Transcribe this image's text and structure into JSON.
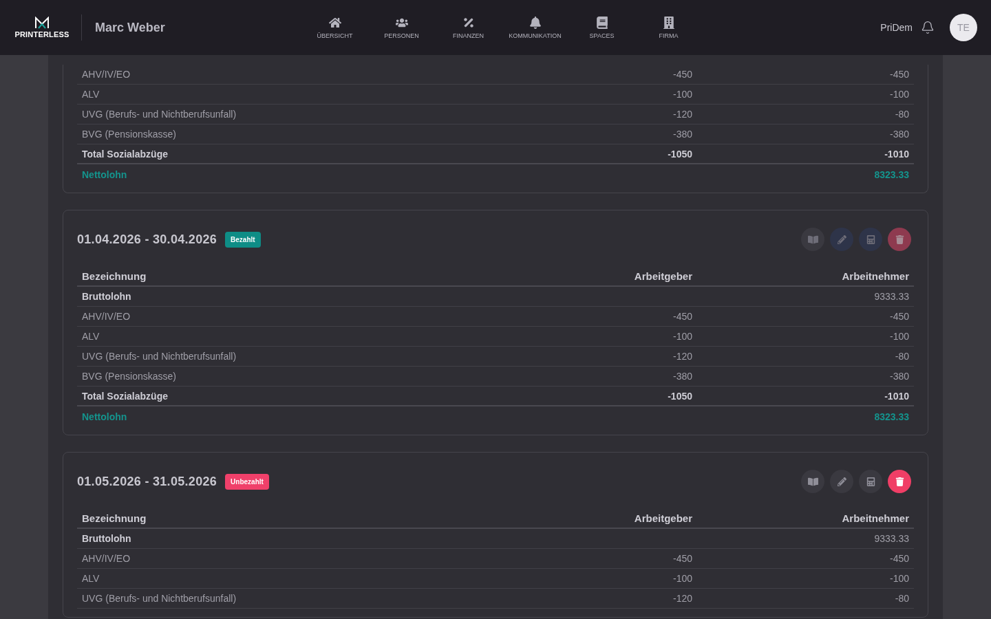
{
  "header": {
    "logo": "PRINTERLESS",
    "user_name": "Marc Weber",
    "nav": [
      {
        "label": "ÜBERSICHT",
        "kind": "home"
      },
      {
        "label": "PERSONEN",
        "kind": "people"
      },
      {
        "label": "FINANZEN",
        "kind": "finance"
      },
      {
        "label": "KOMMUNIKATION",
        "kind": "messages"
      },
      {
        "label": "SPACES",
        "kind": "spaces"
      },
      {
        "label": "FIRMA",
        "kind": "company"
      }
    ],
    "company": "PriDem",
    "avatar": "TE"
  },
  "cards": [
    {
      "partial": true,
      "rows": [
        {
          "kind": "item",
          "label": "AHV/IV/EO",
          "employer": "-450",
          "employee": "-450"
        },
        {
          "kind": "item",
          "label": "ALV",
          "employer": "-100",
          "employee": "-100"
        },
        {
          "kind": "item",
          "label": "UVG (Berufs- und Nichtberufsunfall)",
          "employer": "-120",
          "employee": "-80"
        },
        {
          "kind": "item",
          "label": "BVG (Pensionskasse)",
          "employer": "-380",
          "employee": "-380"
        },
        {
          "kind": "total",
          "label": "Total Sozialabzüge",
          "employer": "-1050",
          "employee": "-1010"
        },
        {
          "kind": "net",
          "label": "Nettolohn",
          "employee": "8323.33"
        }
      ]
    },
    {
      "partial": false,
      "period": "01.04.2026 - 30.04.2026",
      "status": {
        "label": "Bezahlt",
        "paid": true
      },
      "actions_disabled": true,
      "columns": [
        "Bezeichnung",
        "Arbeitgeber",
        "Arbeitnehmer"
      ],
      "rows": [
        {
          "kind": "gross",
          "label": "Bruttolohn",
          "employee": "9333.33"
        },
        {
          "kind": "item",
          "label": "AHV/IV/EO",
          "employer": "-450",
          "employee": "-450"
        },
        {
          "kind": "item",
          "label": "ALV",
          "employer": "-100",
          "employee": "-100"
        },
        {
          "kind": "item",
          "label": "UVG (Berufs- und Nichtberufsunfall)",
          "employer": "-120",
          "employee": "-80"
        },
        {
          "kind": "item",
          "label": "BVG (Pensionskasse)",
          "employer": "-380",
          "employee": "-380"
        },
        {
          "kind": "total",
          "label": "Total Sozialabzüge",
          "employer": "-1050",
          "employee": "-1010"
        },
        {
          "kind": "net",
          "label": "Nettolohn",
          "employee": "8323.33"
        }
      ]
    },
    {
      "partial": false,
      "period": "01.05.2026 - 31.05.2026",
      "status": {
        "label": "Unbezahlt",
        "paid": false
      },
      "actions_disabled": false,
      "columns": [
        "Bezeichnung",
        "Arbeitgeber",
        "Arbeitnehmer"
      ],
      "rows": [
        {
          "kind": "gross",
          "label": "Bruttolohn",
          "employee": "9333.33"
        },
        {
          "kind": "item",
          "label": "AHV/IV/EO",
          "employer": "-450",
          "employee": "-450"
        },
        {
          "kind": "item",
          "label": "ALV",
          "employer": "-100",
          "employee": "-100"
        },
        {
          "kind": "item",
          "label": "UVG (Berufs- und Nichtberufsunfall)",
          "employer": "-120",
          "employee": "-80"
        }
      ]
    }
  ]
}
